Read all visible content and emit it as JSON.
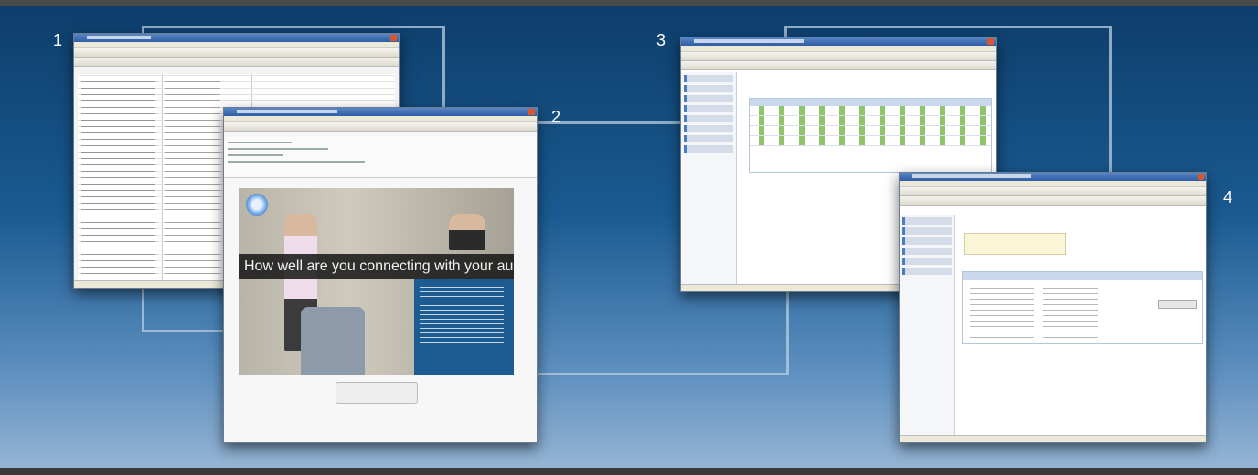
{
  "numbers": [
    "1",
    "2",
    "3",
    "4"
  ],
  "window2": {
    "banner": "How well are you connecting with your audience?"
  },
  "windows": [
    {
      "id": 1,
      "kind": "spreadsheet"
    },
    {
      "id": 2,
      "kind": "email-client"
    },
    {
      "id": 3,
      "kind": "web-app-table"
    },
    {
      "id": 4,
      "kind": "web-app-form"
    }
  ],
  "colors": {
    "background_top": "#0d3d6a",
    "background_bottom": "#9ab8d6",
    "connector": "#b9cde1",
    "banner_blue": "#1d5c93"
  }
}
